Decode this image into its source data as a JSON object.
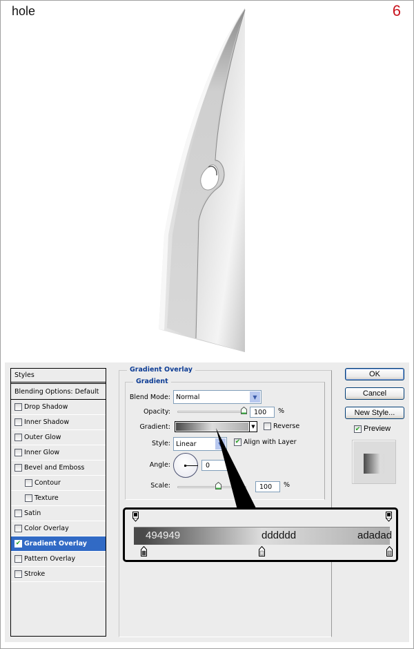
{
  "header": {
    "step_title": "hole",
    "step_number": "6"
  },
  "styles_panel": {
    "header": "Styles",
    "blending": "Blending Options: Default",
    "items": [
      {
        "label": "Drop Shadow",
        "checked": false,
        "indent": false,
        "selected": false
      },
      {
        "label": "Inner Shadow",
        "checked": false,
        "indent": false,
        "selected": false
      },
      {
        "label": "Outer Glow",
        "checked": false,
        "indent": false,
        "selected": false
      },
      {
        "label": "Inner Glow",
        "checked": false,
        "indent": false,
        "selected": false
      },
      {
        "label": "Bevel and Emboss",
        "checked": false,
        "indent": false,
        "selected": false
      },
      {
        "label": "Contour",
        "checked": false,
        "indent": true,
        "selected": false
      },
      {
        "label": "Texture",
        "checked": false,
        "indent": true,
        "selected": false
      },
      {
        "label": "Satin",
        "checked": false,
        "indent": false,
        "selected": false
      },
      {
        "label": "Color Overlay",
        "checked": false,
        "indent": false,
        "selected": false
      },
      {
        "label": "Gradient Overlay",
        "checked": true,
        "indent": false,
        "selected": true
      },
      {
        "label": "Pattern Overlay",
        "checked": false,
        "indent": false,
        "selected": false
      },
      {
        "label": "Stroke",
        "checked": false,
        "indent": false,
        "selected": false
      }
    ]
  },
  "gradient_overlay": {
    "section_title": "Gradient Overlay",
    "group_title": "Gradient",
    "blend_mode_label": "Blend Mode:",
    "blend_mode_value": "Normal",
    "opacity_label": "Opacity:",
    "opacity_value": "100",
    "opacity_unit": "%",
    "opacity_fraction": 1.0,
    "gradient_label": "Gradient:",
    "reverse_label": "Reverse",
    "reverse_checked": false,
    "style_label": "Style:",
    "style_value": "Linear",
    "align_label": "Align with Layer",
    "align_checked": true,
    "angle_label": "Angle:",
    "angle_value": "0",
    "scale_label": "Scale:",
    "scale_value": "100",
    "scale_unit": "%",
    "scale_slider_fraction": 0.6
  },
  "buttons": {
    "ok": "OK",
    "cancel": "Cancel",
    "new_style": "New Style...",
    "preview_label": "Preview",
    "preview_checked": true
  },
  "gradient_editor_callout": {
    "stops": [
      {
        "label": "494949",
        "color": "#494949",
        "position": 0.04
      },
      {
        "label": "dddddd",
        "color": "#dddddd",
        "position": 0.5
      },
      {
        "label": "adadad",
        "color": "#adadad",
        "position": 1.0
      }
    ],
    "opacity_stops": [
      0.0,
      1.0
    ]
  }
}
